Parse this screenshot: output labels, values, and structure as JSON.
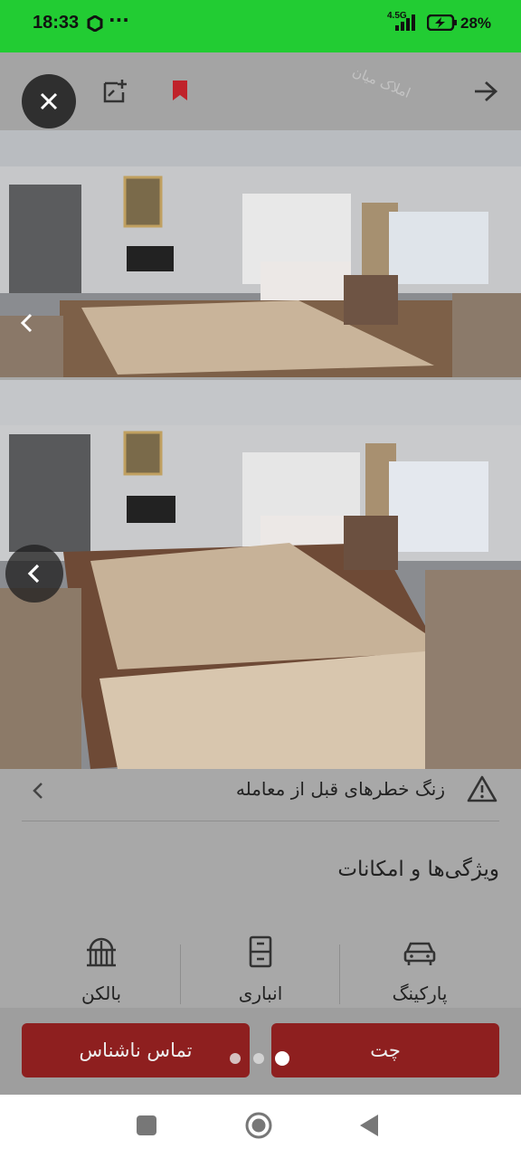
{
  "status": {
    "time": "18:33",
    "dots": "···",
    "network": "4.5G",
    "battery_pct": "28%",
    "bar_color": "#22cc33"
  },
  "header": {
    "close_icon": "close-icon",
    "note_icon": "add-note-icon",
    "bookmark_icon": "bookmark-icon",
    "bookmark_color": "#c0222a",
    "back_icon": "arrow-right-icon",
    "watermark": "املاک میان"
  },
  "warning": {
    "label": "زنگ خطرهای قبل از معامله"
  },
  "features_section": {
    "title": "ویژگی‌ها و امکانات",
    "items": [
      {
        "label": "پارکینگ",
        "icon": "car-icon"
      },
      {
        "label": "انباری",
        "icon": "storage-icon"
      },
      {
        "label": "بالکن",
        "icon": "balcony-icon"
      }
    ]
  },
  "actions": {
    "chat_label": "چت",
    "anon_call_label": "تماس ناشناس",
    "button_color": "#8e1f1f"
  },
  "navbar": {
    "recent_icon": "square-icon",
    "home_icon": "home-circle-icon",
    "back_icon": "triangle-back-icon"
  }
}
